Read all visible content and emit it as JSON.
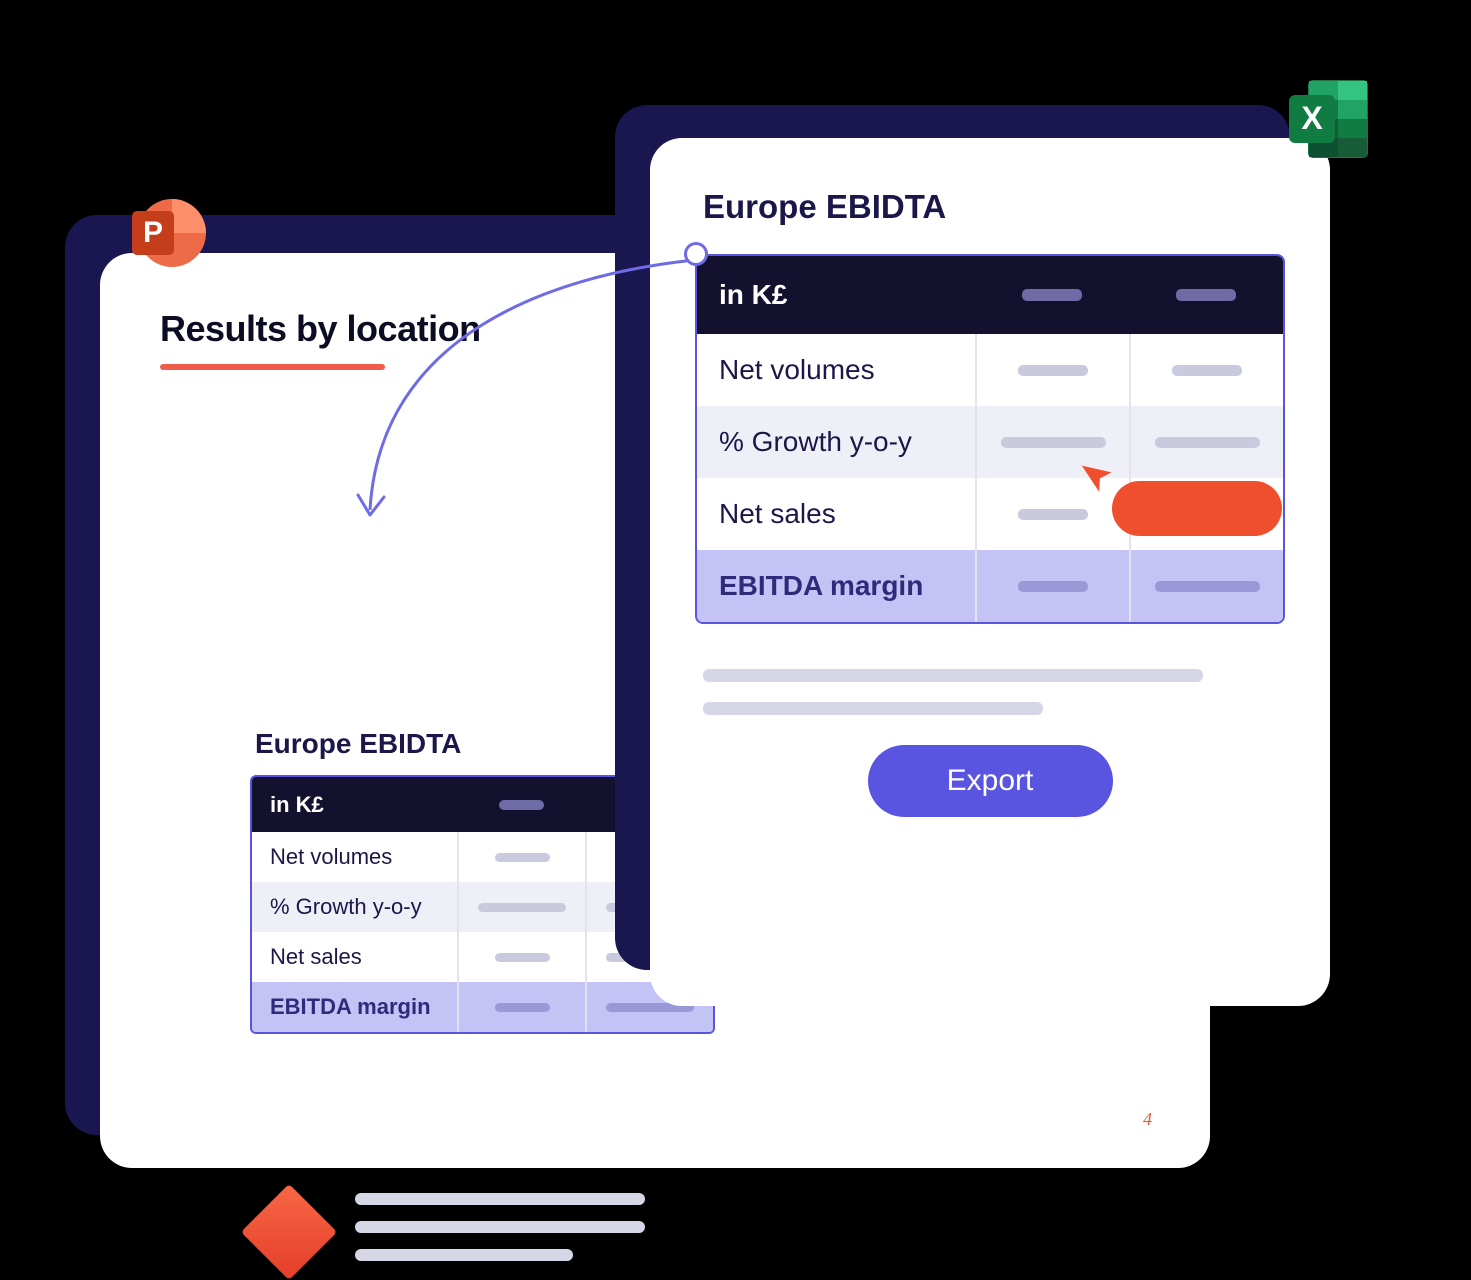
{
  "powerpoint": {
    "title": "Results by location",
    "section_title": "Europe EBIDTA",
    "page_number": "4",
    "table": {
      "header_label": "in K£",
      "rows": [
        {
          "label": "Net volumes"
        },
        {
          "label": "% Growth y-o-y"
        },
        {
          "label": "Net sales"
        },
        {
          "label": "EBITDA margin"
        }
      ]
    }
  },
  "excel": {
    "section_title": "Europe EBIDTA",
    "table": {
      "header_label": "in K£",
      "rows": [
        {
          "label": "Net volumes"
        },
        {
          "label": "% Growth y-o-y"
        },
        {
          "label": "Net sales"
        },
        {
          "label": "EBITDA margin"
        }
      ]
    },
    "export_label": "Export"
  },
  "icons": {
    "powerpoint": "P",
    "excel": "X"
  }
}
